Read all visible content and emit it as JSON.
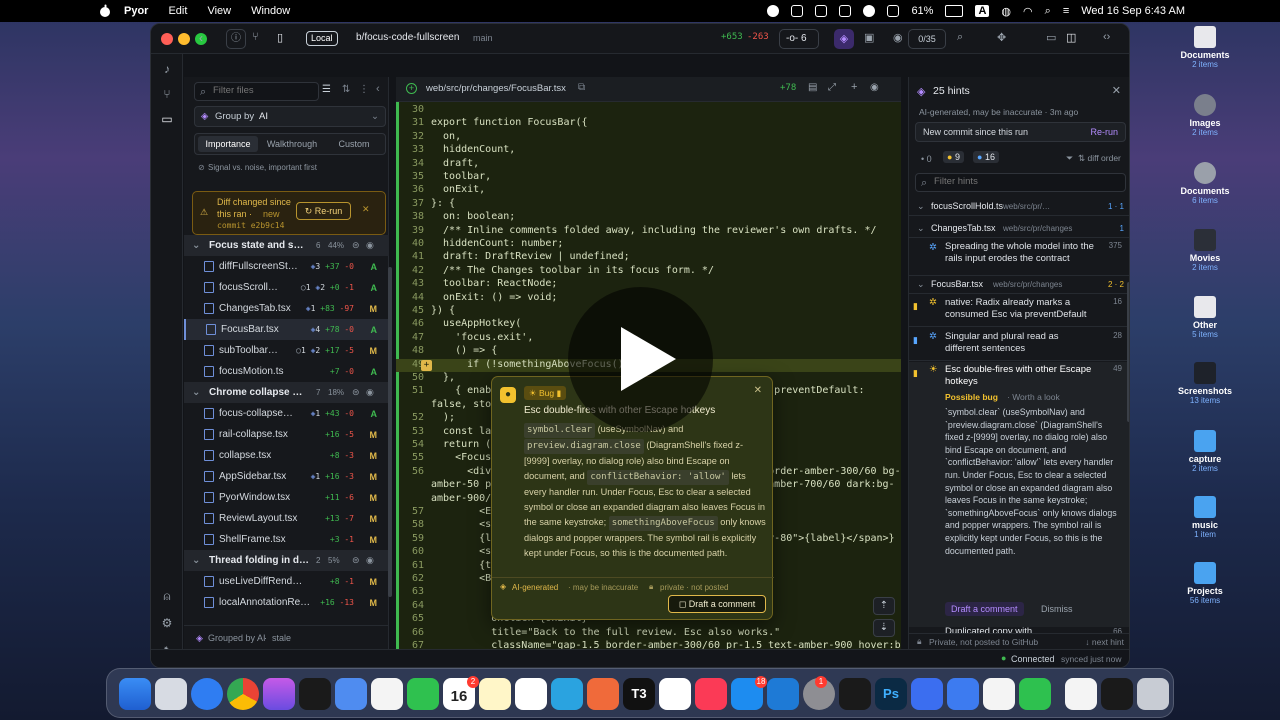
{
  "menubar": {
    "app": "Pyor",
    "items": [
      "Edit",
      "View",
      "Window"
    ],
    "battery": "61%",
    "input": "A",
    "datetime": "Wed 16 Sep  6:43 AM"
  },
  "desktop": [
    {
      "label": "Documents",
      "count": "2 items",
      "icon": "document-icon"
    },
    {
      "label": "Images",
      "count": "2 items",
      "icon": "images-folder-icon"
    },
    {
      "label": "Documents",
      "count": "6 items",
      "icon": "documents-folder-icon"
    },
    {
      "label": "Movies",
      "count": "2 items",
      "icon": "movies-folder-icon"
    },
    {
      "label": "Other",
      "count": "5 items",
      "icon": "other-folder-icon"
    },
    {
      "label": "Screenshots",
      "count": "13 items",
      "icon": "screenshots-folder-icon"
    },
    {
      "label": "capture",
      "count": "2 items",
      "icon": "folder-icon"
    },
    {
      "label": "music",
      "count": "1 item",
      "icon": "folder-icon"
    },
    {
      "label": "Projects",
      "count": "56 items",
      "icon": "folder-icon"
    }
  ],
  "topbar": {
    "local_badge": "Local",
    "branch": "b/focus-code-fullscreen",
    "base": "main",
    "additions": "+653",
    "deletions": "-263",
    "commits": "6",
    "progress": "0/35"
  },
  "sidebar": {
    "filter_placeholder": "Filter files",
    "group_by_label": "Group by",
    "group_by_value": "AI",
    "tabs": [
      "Importance",
      "Walkthrough",
      "Custom"
    ],
    "tab_hint": "Signal vs. noise, important first",
    "diff_notice": {
      "line1": "Diff changed since",
      "line2": "this ran ·",
      "new": "new",
      "commit": "commit e2b9c14",
      "rerun": "Re-run"
    },
    "groups": [
      {
        "title": "Focus state and s…",
        "count": "6",
        "pct": "44%",
        "files": [
          {
            "name": "diffFullscreenSt…",
            "comments": "",
            "extra": "3",
            "add": "+37",
            "del": "-0",
            "status": "A"
          },
          {
            "name": "focusScroll…",
            "comments": "1",
            "extra": "2",
            "add": "+0",
            "del": "-1",
            "status": "A"
          },
          {
            "name": "ChangesTab.tsx",
            "comments": "",
            "extra": "1",
            "add": "+83",
            "del": "-97",
            "status": "M"
          },
          {
            "name": "FocusBar.tsx",
            "comments": "",
            "extra": "4",
            "add": "+78",
            "del": "-0",
            "status": "A"
          },
          {
            "name": "subToolbar…",
            "comments": "1",
            "extra": "2",
            "add": "+17",
            "del": "-5",
            "status": "M"
          },
          {
            "name": "focusMotion.ts",
            "comments": "",
            "extra": "",
            "add": "+7",
            "del": "-0",
            "status": "A"
          }
        ]
      },
      {
        "title": "Chrome collapse …",
        "count": "7",
        "pct": "18%",
        "files": [
          {
            "name": "focus-collapse…",
            "comments": "",
            "extra": "1",
            "add": "+43",
            "del": "-0",
            "status": "A"
          },
          {
            "name": "rail-collapse.tsx",
            "comments": "",
            "extra": "",
            "add": "+16",
            "del": "-5",
            "status": "M"
          },
          {
            "name": "collapse.tsx",
            "comments": "",
            "extra": "",
            "add": "+8",
            "del": "-3",
            "status": "M"
          },
          {
            "name": "AppSidebar.tsx",
            "comments": "",
            "extra": "1",
            "add": "+16",
            "del": "-3",
            "status": "M"
          },
          {
            "name": "PyorWindow.tsx",
            "comments": "",
            "extra": "",
            "add": "+11",
            "del": "-6",
            "status": "M"
          },
          {
            "name": "ReviewLayout.tsx",
            "comments": "",
            "extra": "",
            "add": "+13",
            "del": "-7",
            "status": "M"
          },
          {
            "name": "ShellFrame.tsx",
            "comments": "",
            "extra": "",
            "add": "+3",
            "del": "-1",
            "status": "M"
          }
        ]
      },
      {
        "title": "Thread folding in d…",
        "count": "2",
        "pct": "5%",
        "files": [
          {
            "name": "useLiveDiffRend…",
            "comments": "",
            "extra": "",
            "add": "+8",
            "del": "-1",
            "status": "M"
          },
          {
            "name": "localAnnotationRe…",
            "comments": "",
            "extra": "",
            "add": "+16",
            "del": "-13",
            "status": "M"
          }
        ]
      }
    ],
    "footer": {
      "grouped": "Grouped by AI",
      "stale": "stale"
    }
  },
  "code": {
    "path": "web/src/pr/changes/FocusBar.tsx",
    "additions": "+78",
    "lines": [
      {
        "n": "30",
        "t": ""
      },
      {
        "n": "31",
        "t": "export function FocusBar({"
      },
      {
        "n": "32",
        "t": "  on,"
      },
      {
        "n": "33",
        "t": "  hiddenCount,"
      },
      {
        "n": "34",
        "t": "  draft,"
      },
      {
        "n": "35",
        "t": "  toolbar,"
      },
      {
        "n": "36",
        "t": "  onExit,"
      },
      {
        "n": "37",
        "t": "}: {"
      },
      {
        "n": "38",
        "t": "  on: boolean;"
      },
      {
        "n": "39",
        "t": "  /** Inline comments folded away, including the reviewer's own drafts. */"
      },
      {
        "n": "40",
        "t": "  hiddenCount: number;"
      },
      {
        "n": "41",
        "t": "  draft: DraftReview | undefined;"
      },
      {
        "n": "42",
        "t": "  /** The Changes toolbar in its focus form. */"
      },
      {
        "n": "43",
        "t": "  toolbar: ReactNode;"
      },
      {
        "n": "44",
        "t": "  onExit: () => void;"
      },
      {
        "n": "45",
        "t": "}) {"
      },
      {
        "n": "46",
        "t": "  useAppHotkey("
      },
      {
        "n": "47",
        "t": "    'focus.exit',"
      },
      {
        "n": "48",
        "t": "    () => {"
      },
      {
        "n": "49",
        "t": "      if (!somethingAboveFocus()) on"
      },
      {
        "n": "50",
        "t": "  },"
      },
      {
        "n": "51",
        "t": "    { enabl                                            , preventDefault:"
      },
      {
        "n": "",
        "t": "false, stop"
      },
      {
        "n": "52",
        "t": "  );"
      },
      {
        "n": "53",
        "t": "  const lab"
      },
      {
        "n": "54",
        "t": "  return ("
      },
      {
        "n": "55",
        "t": "    <FocusC"
      },
      {
        "n": "56",
        "t": "      <div                                             border-amber-300/60 bg-"
      },
      {
        "n": "",
        "t": "amber-50 px                                           e-amber-700/60 dark:bg-"
      },
      {
        "n": "",
        "t": "amber-900/3"
      },
      {
        "n": "57",
        "t": "        <Ey"
      },
      {
        "n": "58",
        "t": "        <sp"
      },
      {
        "n": "59",
        "t": "        {la                                            ty-80\">{label}</span>}"
      },
      {
        "n": "60",
        "t": "        <sp"
      },
      {
        "n": "61",
        "t": "        {to"
      },
      {
        "n": "62",
        "t": "        <Bu"
      },
      {
        "n": "63",
        "t": "          v"
      },
      {
        "n": "64",
        "t": "          s"
      },
      {
        "n": "65",
        "t": "          onClick={onExit}"
      },
      {
        "n": "66",
        "t": "          title=\"Back to the full review. Esc also works.\""
      },
      {
        "n": "67",
        "t": "          className=\"gap-1.5 border-amber-300/60 pr-1.5 text-amber-900 hover:bg-amber-"
      }
    ]
  },
  "popover": {
    "tag": "Bug",
    "title": "Esc double-fires with other Escape hotkeys",
    "body": [
      {
        "chip": "symbol.clear",
        "text": " (useSymbolNav) and "
      },
      {
        "chip": "preview.diagram.close",
        "text": " (DiagramShell's fixed z-[9999] overlay, no dialog role) also bind Escape on document, and "
      },
      {
        "chip": "conflictBehavior: 'allow'",
        "text": " lets every handler run. Under Focus, Esc to clear a selected symbol or close an expanded diagram also leaves Focus in the same keystroke; "
      },
      {
        "chip": "somethingAboveFocus",
        "text": " only knows dialogs and popper wrappers. The symbol rail is explicitly kept under Focus, so this is the documented path."
      }
    ],
    "footer_ai": "AI-generated",
    "footer_inacc": "· may be inaccurate",
    "footer_private": "private · not posted",
    "draft_button": "Draft a comment"
  },
  "hints": {
    "title": "25 hints",
    "meta": "AI-generated, may be inaccurate · 3m ago",
    "new_commit": "New commit since this run",
    "rerun": "Re-run",
    "counts": {
      "zero": "0",
      "yellow": "9",
      "blue": "16"
    },
    "diff_order": "diff order",
    "filter_placeholder": "Filter hints",
    "files": [
      {
        "name": "focusScrollHold.ts",
        "path": "web/src/pr/…",
        "count": "1 · 1"
      },
      {
        "name": "ChangesTab.tsx",
        "path": "web/src/pr/changes",
        "count": "1"
      }
    ],
    "item1": {
      "text": "Spreading the whole model into the rails input erodes the contract",
      "line": "375"
    },
    "file3": {
      "name": "FocusBar.tsx",
      "path": "web/src/pr/changes",
      "count": "2 · 2"
    },
    "item2": {
      "text": "native: Radix already marks a consumed Esc via preventDefault",
      "line": "16"
    },
    "item3": {
      "text": "Singular and plural read as different sentences",
      "line": "28"
    },
    "item4": {
      "text": "Esc double-fires with other Escape hotkeys",
      "line": "49",
      "tag": "Possible bug",
      "sub": "· Worth a look",
      "body": "`symbol.clear` (useSymbolNav) and `preview.diagram.close` (DiagramShell's fixed z-[9999] overlay, no dialog role) also bind Escape on document, and `conflictBehavior: 'allow'` lets every handler run. Under Focus, Esc to clear a selected symbol or close an expanded diagram also leaves Focus in the same keystroke; `somethingAboveFocus` only knows dialogs and popper wrappers. The symbol rail is explicitly kept under Focus, so this is the documented path."
    },
    "draft": "Draft a comment",
    "dismiss": "Dismiss",
    "item5": {
      "text": "Duplicated copy with",
      "line": "66"
    },
    "footer_private": "Private, not posted to GitHub",
    "footer_next": "next hint"
  },
  "status": {
    "connected": "Connected",
    "synced": "synced just now"
  },
  "dock": {
    "calendar_day": "16",
    "calendar_badge": "2",
    "appstore_badge": "18",
    "settings_badge": "1"
  }
}
